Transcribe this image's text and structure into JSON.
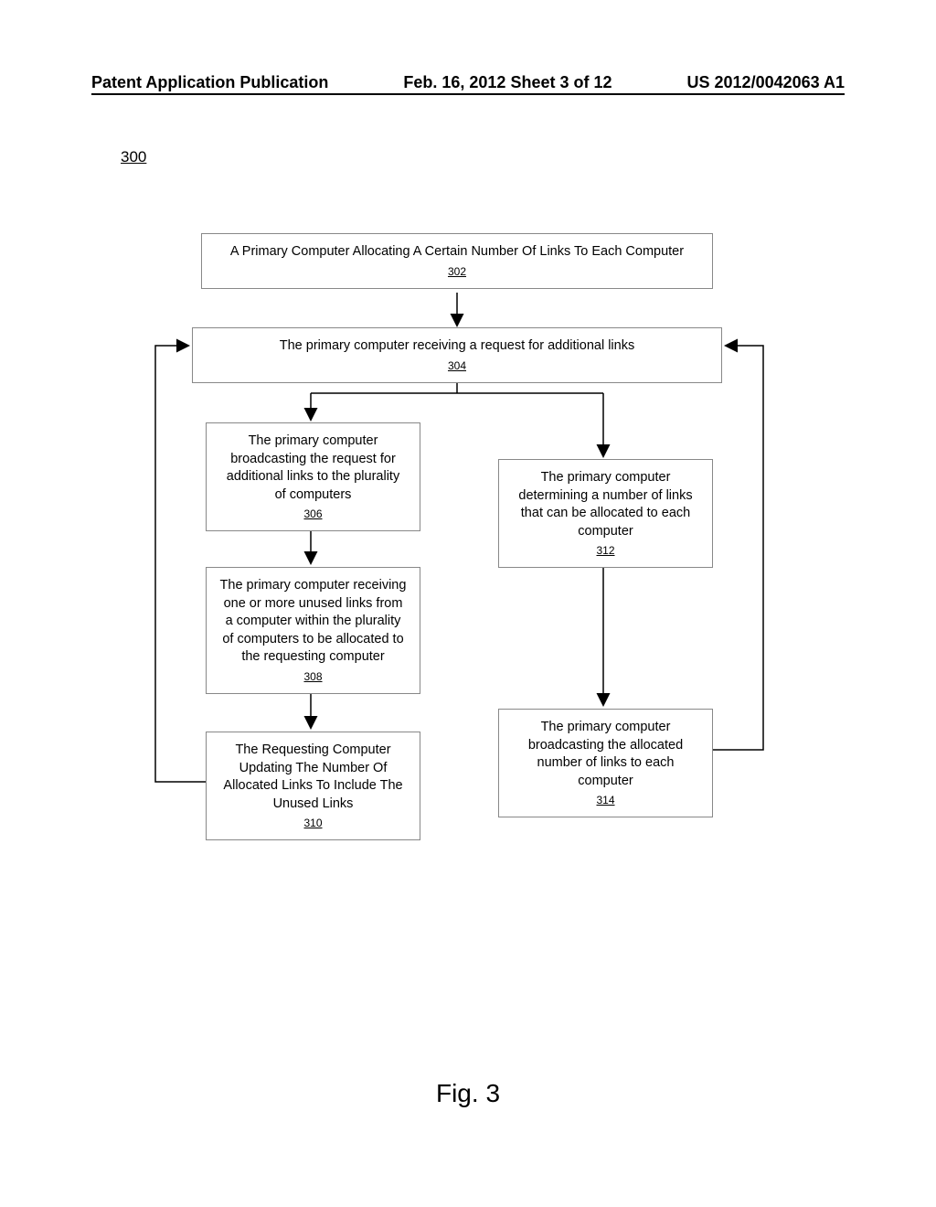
{
  "header": {
    "left": "Patent Application Publication",
    "center": "Feb. 16, 2012  Sheet 3 of 12",
    "right": "US 2012/0042063 A1"
  },
  "figNum": "300",
  "boxes": {
    "b302": {
      "text": "A Primary Computer Allocating A Certain Number Of Links To Each Computer",
      "ref": "302"
    },
    "b304": {
      "text": "The primary computer receiving a request for additional links",
      "ref": "304"
    },
    "b306": {
      "text": "The primary computer broadcasting the request for additional links to the plurality of computers",
      "ref": "306"
    },
    "b308": {
      "text": "The primary computer receiving one or more unused links from a computer within the plurality of computers to be allocated to the requesting computer",
      "ref": "308"
    },
    "b310": {
      "text": "The Requesting Computer Updating The Number Of Allocated Links To Include The Unused Links",
      "ref": "310"
    },
    "b312": {
      "text": "The primary computer determining a number of links that can be allocated to each computer",
      "ref": "312"
    },
    "b314": {
      "text": "The primary computer broadcasting the allocated number of links to each computer",
      "ref": "314"
    }
  },
  "caption": "Fig. 3"
}
